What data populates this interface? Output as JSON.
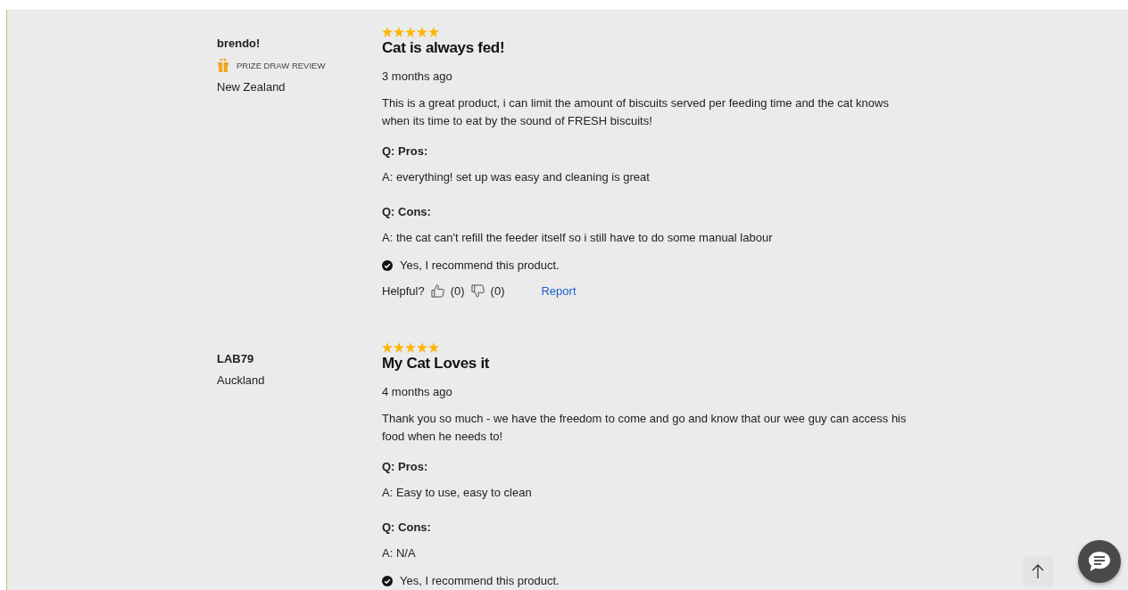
{
  "reviews": [
    {
      "author": "brendo!",
      "badge": "PRIZE DRAW REVIEW",
      "location": "New Zealand",
      "stars": 5,
      "title": "Cat is always fed!",
      "date": "3 months ago",
      "body": "This is a great product, i can limit the amount of biscuits served per feeding time and the cat knows when its time to eat by the sound of FRESH biscuits!",
      "qa": [
        {
          "q": "Q: Pros:",
          "a": "A: everything! set up was easy and cleaning is great"
        },
        {
          "q": "Q: Cons:",
          "a": "A: the cat can't refill the feeder itself so i still have to do some manual labour"
        }
      ],
      "recommend": "Yes, I recommend this product.",
      "helpful": {
        "label": "Helpful?",
        "up": "(0)",
        "down": "(0)",
        "report": "Report"
      }
    },
    {
      "author": "LAB79",
      "location": "Auckland",
      "stars": 5,
      "title": "My Cat Loves it",
      "date": "4 months ago",
      "body": "Thank you so much - we have the freedom to come and go and know that our wee guy can access his food when he needs to!",
      "qa": [
        {
          "q": "Q: Pros:",
          "a": "A: Easy to use, easy to clean"
        },
        {
          "q": "Q: Cons:",
          "a": "A: N/A"
        }
      ],
      "recommend": "Yes, I recommend this product."
    }
  ]
}
